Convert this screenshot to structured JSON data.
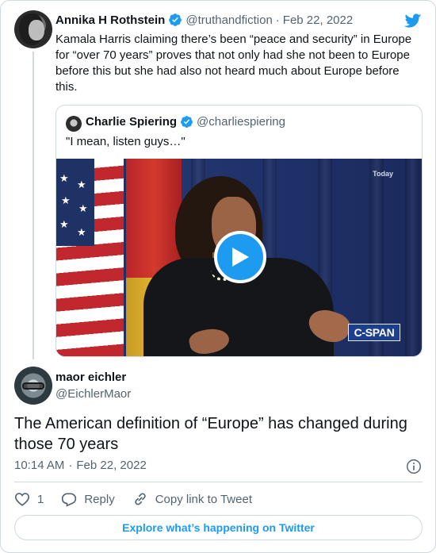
{
  "parent_tweet": {
    "author_name": "Annika H Rothstein",
    "handle": "@truthandfiction",
    "date": "Feb 22, 2022",
    "text": "Kamala Harris claiming there’s been “peace and security” in Europe for “over 70 years” proves that not only had she not been to Europe before this but she had also not heard much about Europe before this."
  },
  "quoted_tweet": {
    "author_name": "Charlie Spiering",
    "handle": "@charliespiering",
    "text": "\"I mean, listen guys…\"",
    "video": {
      "badge": "Today",
      "network_logo": "C-SPAN"
    }
  },
  "reply": {
    "author_name": "maor eichler",
    "handle": "@EichlerMaor",
    "text": "The American definition of “Europe” has changed during those 70 years",
    "time": "10:14 AM",
    "date": "Feb 22, 2022"
  },
  "actions": {
    "like_count": "1",
    "reply_label": "Reply",
    "copy_label": "Copy link to Tweet"
  },
  "explore_label": "Explore what’s happening on Twitter",
  "separator": "·",
  "colors": {
    "twitter_blue": "#1d9bf0",
    "text_primary": "#0f1419",
    "text_secondary": "#536471",
    "border": "#cfd9de"
  },
  "icons": [
    "twitter-bird-icon",
    "verified-badge-icon",
    "play-icon",
    "info-icon",
    "heart-icon",
    "reply-icon",
    "link-icon"
  ]
}
